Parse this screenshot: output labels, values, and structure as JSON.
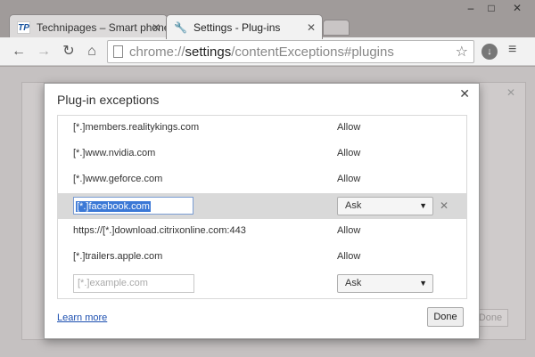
{
  "browser": {
    "tabs": [
      {
        "title": "Technipages – Smart phone",
        "favicon": "TP",
        "close": "✕"
      },
      {
        "title": "Settings - Plug-ins",
        "favicon": "wrench-icon",
        "close": "✕"
      }
    ],
    "window_controls": {
      "minimize": "–",
      "maximize": "□",
      "close": "✕"
    },
    "url_scheme": "chrome://",
    "url_host": "settings",
    "url_path": "/contentExceptions#plugins"
  },
  "dialog": {
    "title": "Plug-in exceptions",
    "close": "✕",
    "rows": [
      {
        "pattern": "[*.]members.realitykings.com",
        "setting": "Allow"
      },
      {
        "pattern": "[*.]www.nvidia.com",
        "setting": "Allow"
      },
      {
        "pattern": "[*.]www.geforce.com",
        "setting": "Allow"
      },
      {
        "pattern": "[*.]facebook.com",
        "setting": "Ask",
        "selected": true
      },
      {
        "pattern": "https://[*.]download.citrixonline.com:443",
        "setting": "Allow"
      },
      {
        "pattern": "[*.]trailers.apple.com",
        "setting": "Allow"
      }
    ],
    "new_row": {
      "placeholder": "[*.]example.com",
      "setting": "Ask"
    },
    "delete_glyph": "✕",
    "learn_more": "Learn more",
    "done": "Done"
  },
  "behind": {
    "close": "✕",
    "done": "Done"
  }
}
